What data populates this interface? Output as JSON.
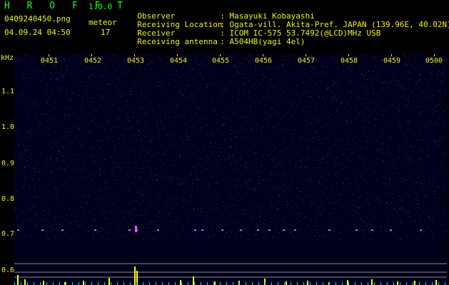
{
  "header": {
    "app_title": "H R O F F T",
    "app_version": "1.0.0",
    "file_name": "0409240450.png",
    "meteor_label": "meteor",
    "date_time": "04.09.24 04:50",
    "meteor_count": "17"
  },
  "info": {
    "observer": {
      "label": "Observer",
      "value": ": Masayuki Kobayashi"
    },
    "location": {
      "label": "Receiving Location",
      "value": ": Ogata-vill. Akita-Pref. JAPAN (139.96E, 40.02N)"
    },
    "receiver": {
      "label": "Receiver",
      "value": ": ICOM IC-575 53.7492(@LCD)MHz USB"
    },
    "antenna": {
      "label": "Receiving antenna",
      "value": ": A504HB(yagi 4el)"
    }
  },
  "spectrogram": {
    "unit": "kHz",
    "time_labels": [
      "0451",
      "0452",
      "0453",
      "0454",
      "0455",
      "0456",
      "0457",
      "0458",
      "0459",
      "0500"
    ],
    "freq_labels": [
      "1.1",
      "1.0",
      "0.9",
      "0.8",
      "0.7",
      "0.6"
    ],
    "colors": {
      "axis_text": "#f2f200",
      "background": "#00001a",
      "grid": "#8a8a8a",
      "echo": "#ff44ff",
      "bar": "#ffff00",
      "bar2": "#00e0ff"
    }
  }
}
